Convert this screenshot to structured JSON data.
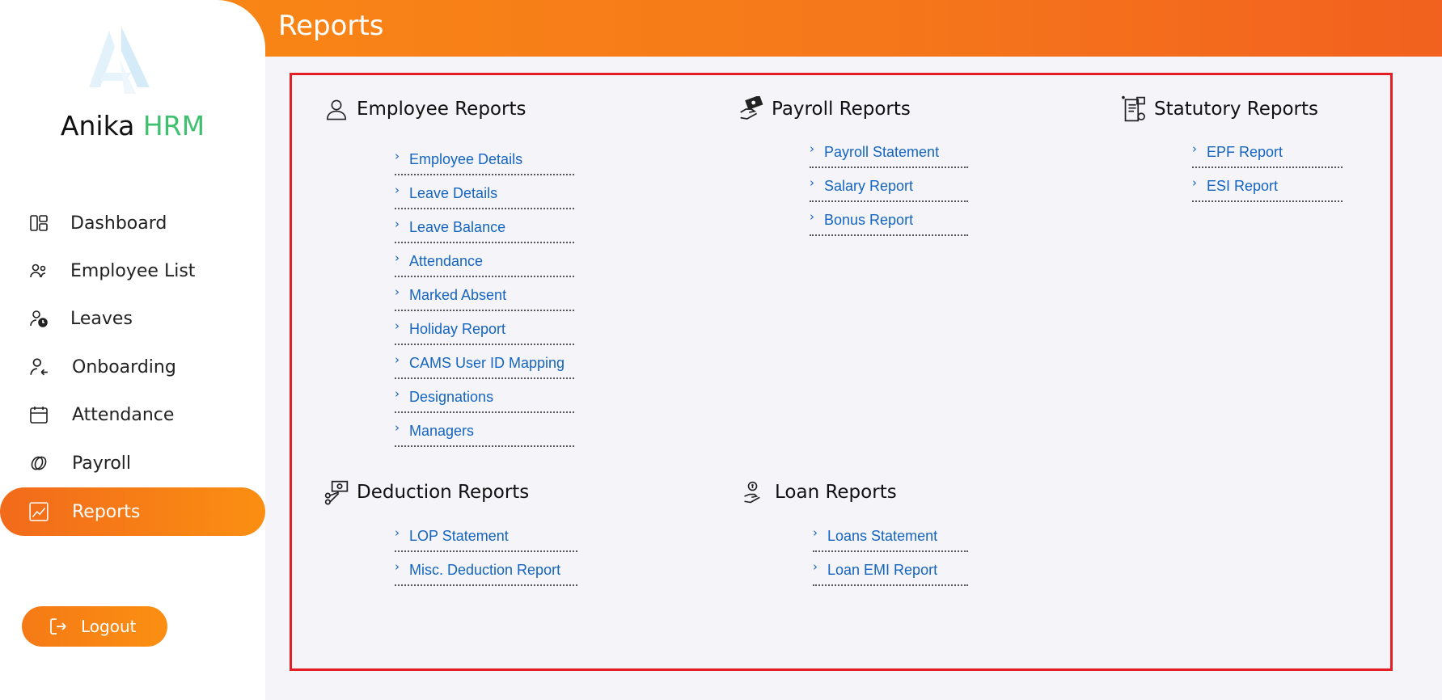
{
  "header": {
    "title": "Reports"
  },
  "brand": {
    "name": "Anika",
    "suffix": "HRM"
  },
  "sidebar": {
    "items": [
      {
        "label": "Dashboard",
        "icon": "dashboard-icon"
      },
      {
        "label": "Employee List",
        "icon": "users-icon"
      },
      {
        "label": "Leaves",
        "icon": "leave-clock-icon"
      },
      {
        "label": "Onboarding",
        "icon": "user-arrow-icon"
      },
      {
        "label": "Attendance",
        "icon": "calendar-icon"
      },
      {
        "label": "Payroll",
        "icon": "payroll-icon"
      },
      {
        "label": "Reports",
        "icon": "reports-chart-icon",
        "active": true
      }
    ],
    "logout_label": "Logout"
  },
  "sections": {
    "employee": {
      "title": "Employee Reports",
      "icon": "employee-icon",
      "links": [
        "Employee Details",
        "Leave Details",
        "Leave Balance",
        "Attendance",
        "Marked Absent",
        "Holiday Report",
        "CAMS User ID Mapping",
        "Designations",
        "Managers"
      ]
    },
    "payroll": {
      "title": "Payroll Reports",
      "icon": "money-hand-icon",
      "links": [
        "Payroll Statement",
        "Salary Report",
        "Bonus Report"
      ]
    },
    "statutory": {
      "title": "Statutory Reports",
      "icon": "document-icon",
      "links": [
        "EPF Report",
        "ESI Report"
      ]
    },
    "deduction": {
      "title": "Deduction Reports",
      "icon": "cash-scissors-icon",
      "links": [
        "LOP Statement",
        "Misc. Deduction Report"
      ]
    },
    "loan": {
      "title": "Loan Reports",
      "icon": "coin-hand-icon",
      "links": [
        "Loans Statement",
        "Loan EMI Report"
      ]
    }
  },
  "colors": {
    "accent": "#f57a16",
    "link": "#1565c0",
    "brand_highlight": "#3fc06e",
    "panel_border": "#e41e26"
  }
}
